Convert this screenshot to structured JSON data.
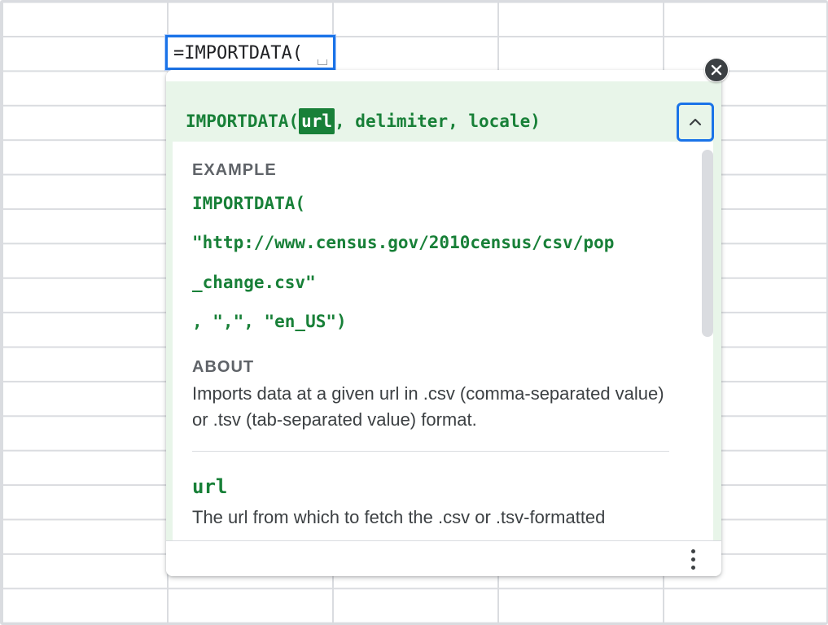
{
  "cell": {
    "formula": "=IMPORTDATA("
  },
  "help": {
    "function_name": "IMPORTDATA(",
    "active_param": "url",
    "rest_params": ", delimiter, locale)",
    "example_label": "EXAMPLE",
    "example_lines": [
      "IMPORTDATA(",
      "\"http://www.census.gov/2010census/csv/pop",
      "_change.csv\"",
      ", \",\", \"en_US\")"
    ],
    "about_label": "ABOUT",
    "about_text": "Imports data at a given url in .csv (comma-separated value) or .tsv (tab-separated value) format.",
    "param_name": "url",
    "param_desc": "The url from which to fetch the .csv or .tsv-formatted"
  },
  "icons": {
    "collapse": "chevron-up-icon",
    "close": "close-icon",
    "more": "more-vert-icon"
  },
  "colors": {
    "accent_blue": "#1a73e8",
    "formula_green": "#188038",
    "header_bg": "#e8f5e9"
  }
}
